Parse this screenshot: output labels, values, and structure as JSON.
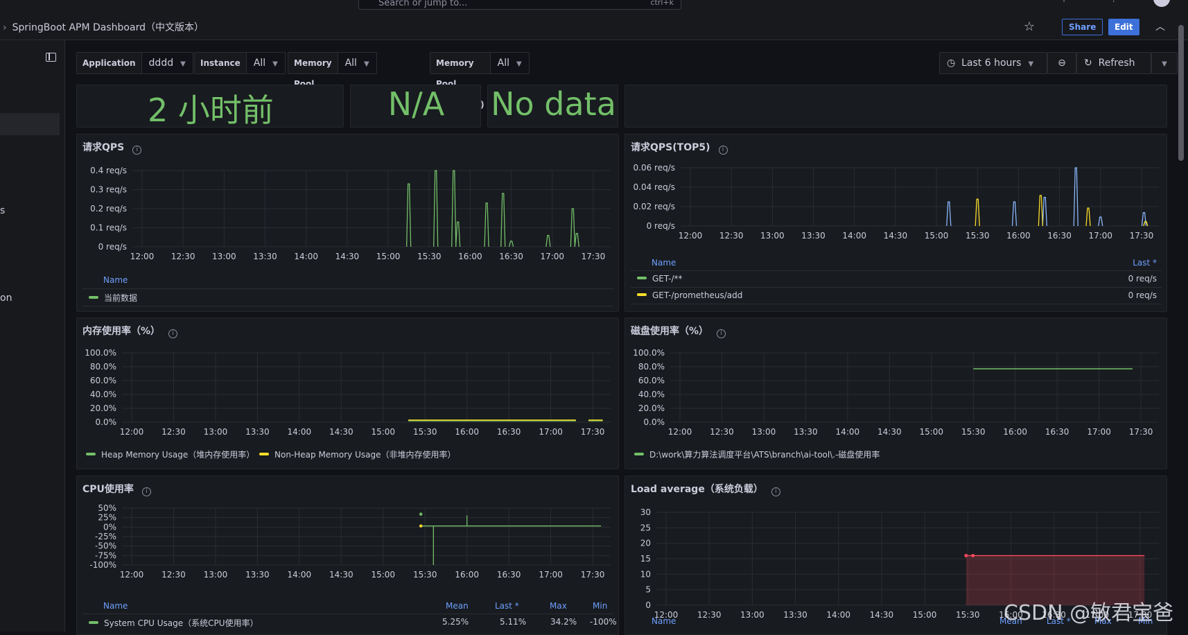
{
  "topbar": {
    "search_placeholder": "Search or jump to...",
    "search_shortcut": "ctrl+k",
    "breadcrumb": "SpringBoot APM Dashboard（中文版本）",
    "share_label": "Share",
    "edit_label": "Edit"
  },
  "sidebar": {
    "fragments": [
      "s",
      "on"
    ]
  },
  "variables": [
    {
      "label": "Application",
      "value": "dddd"
    },
    {
      "label": "Instance",
      "value": "All"
    },
    {
      "label": "Memory Pool (heap)",
      "value": "All"
    },
    {
      "label": "Memory Pool (nonheap)",
      "value": "All"
    }
  ],
  "time": {
    "range_label": "Last 6 hours",
    "refresh_label": "Refresh"
  },
  "stats": {
    "uptime": "2 小时前",
    "stat2": "N/A",
    "stat3": "No data"
  },
  "colors": {
    "green": "#73bf69",
    "yellow": "#fade2a",
    "blue": "#8ab8ff",
    "red": "#f2495c",
    "accent": "#3d71d9"
  },
  "panels": {
    "qps": {
      "title": "请求QPS",
      "legend_header": "Name",
      "legend": [
        {
          "name": "当前数据",
          "color": "#73bf69"
        }
      ]
    },
    "qps_top5": {
      "title": "请求QPS(TOP5)",
      "legend_header": "Name",
      "legend_col": "Last *",
      "legend": [
        {
          "name": "GET-/**",
          "color": "#73bf69",
          "last": "0 req/s"
        },
        {
          "name": "GET-/prometheus/add",
          "color": "#fade2a",
          "last": "0 req/s"
        }
      ]
    },
    "memory": {
      "title": "内存使用率（%）",
      "legend": [
        {
          "name": "Heap Memory Usage（堆内存使用率）",
          "color": "#73bf69"
        },
        {
          "name": "Non-Heap Memory Usage（非堆内存使用率）",
          "color": "#fade2a"
        }
      ]
    },
    "disk": {
      "title": "磁盘使用率（%）",
      "legend": [
        {
          "name": "D:\\work\\算力算法调度平台\\ATS\\branch\\ai-tool\\.-磁盘使用率",
          "color": "#73bf69"
        }
      ]
    },
    "cpu": {
      "title": "CPU使用率",
      "legend_header": "Name",
      "legend_cols": [
        "Mean",
        "Last *",
        "Max",
        "Min"
      ],
      "legend": [
        {
          "name": "System CPU Usage（系统CPU使用率）",
          "color": "#73bf69",
          "mean": "5.25%",
          "last": "5.11%",
          "max": "34.2%",
          "min": "-100%"
        }
      ]
    },
    "load": {
      "title": "Load average（系统负载）",
      "legend_header": "Name",
      "legend_cols": [
        "Mean",
        "Last *",
        "Max",
        "Min"
      ]
    }
  },
  "chart_data": [
    {
      "type": "line",
      "panel": "请求QPS",
      "x": [
        "12:00",
        "12:30",
        "13:00",
        "13:30",
        "14:00",
        "14:30",
        "15:00",
        "15:30",
        "16:00",
        "16:30",
        "17:00",
        "17:30"
      ],
      "y_ticks": [
        "0 req/s",
        "0.1 req/s",
        "0.2 req/s",
        "0.3 req/s",
        "0.4 req/s"
      ],
      "ylim": [
        0,
        0.4
      ],
      "series": [
        {
          "name": "当前数据",
          "color": "#73bf69",
          "points": [
            [
              15.25,
              0.33
            ],
            [
              15.58,
              0.4
            ],
            [
              15.8,
              0.4
            ],
            [
              15.85,
              0.13
            ],
            [
              16.2,
              0.23
            ],
            [
              16.4,
              0.28
            ],
            [
              16.5,
              0.03
            ],
            [
              16.95,
              0.06
            ],
            [
              17.25,
              0.2
            ],
            [
              17.3,
              0.07
            ]
          ]
        }
      ]
    },
    {
      "type": "line",
      "panel": "请求QPS(TOP5)",
      "x": [
        "12:00",
        "12:30",
        "13:00",
        "13:30",
        "14:00",
        "14:30",
        "15:00",
        "15:30",
        "16:00",
        "16:30",
        "17:00",
        "17:30"
      ],
      "y_ticks": [
        "0 req/s",
        "0.02 req/s",
        "0.04 req/s",
        "0.06 req/s"
      ],
      "ylim": [
        0,
        0.065
      ],
      "series": [
        {
          "name": "GET-/**",
          "color": "#8ab8ff",
          "points": [
            [
              15.15,
              0.027
            ],
            [
              15.95,
              0.027
            ],
            [
              16.32,
              0.032
            ],
            [
              16.7,
              0.065
            ],
            [
              17.0,
              0.01
            ],
            [
              17.53,
              0.015
            ]
          ]
        },
        {
          "name": "GET-/prometheus/add",
          "color": "#fade2a",
          "points": [
            [
              15.5,
              0.03
            ],
            [
              16.27,
              0.034
            ],
            [
              16.85,
              0.02
            ],
            [
              17.55,
              0.005
            ]
          ]
        }
      ]
    },
    {
      "type": "line",
      "panel": "内存使用率（%）",
      "x": [
        "12:00",
        "12:30",
        "13:00",
        "13:30",
        "14:00",
        "14:30",
        "15:00",
        "15:30",
        "16:00",
        "16:30",
        "17:00",
        "17:30"
      ],
      "y_ticks": [
        "0.0%",
        "20.0%",
        "40.0%",
        "60.0%",
        "80.0%",
        "100.0%"
      ],
      "ylim": [
        0,
        100
      ],
      "series": [
        {
          "name": "Heap Memory Usage（堆内存使用率）",
          "color": "#73bf69",
          "segments": [
            [
              15.3,
              17.3,
              2
            ],
            [
              17.45,
              17.62,
              2
            ]
          ]
        },
        {
          "name": "Non-Heap Memory Usage（非堆内存使用率）",
          "color": "#fade2a",
          "segments": [
            [
              15.3,
              17.3,
              3
            ],
            [
              17.45,
              17.62,
              3
            ]
          ]
        }
      ]
    },
    {
      "type": "line",
      "panel": "磁盘使用率（%）",
      "x": [
        "12:00",
        "12:30",
        "13:00",
        "13:30",
        "14:00",
        "14:30",
        "15:00",
        "15:30",
        "16:00",
        "16:30",
        "17:00",
        "17:30"
      ],
      "y_ticks": [
        "0.0%",
        "20.0%",
        "40.0%",
        "60.0%",
        "80.0%",
        "100.0%"
      ],
      "ylim": [
        0,
        100
      ],
      "series": [
        {
          "name": "D:\\work\\算力算法调度平台\\ATS\\branch\\ai-tool\\.-磁盘使用率",
          "color": "#73bf69",
          "segments": [
            [
              15.5,
              17.4,
              77
            ]
          ]
        }
      ]
    },
    {
      "type": "line",
      "panel": "CPU使用率",
      "x": [
        "12:00",
        "12:30",
        "13:00",
        "13:30",
        "14:00",
        "14:30",
        "15:00",
        "15:30",
        "16:00",
        "16:30",
        "17:00",
        "17:30"
      ],
      "y_ticks": [
        "-100%",
        "-75%",
        "-50%",
        "-25%",
        "0%",
        "25%",
        "50%"
      ],
      "ylim": [
        -100,
        50
      ],
      "series": [
        {
          "name": "System CPU Usage（系统CPU使用率）",
          "color": "#73bf69",
          "mean": 5.25,
          "last": 5.11,
          "max": 34.2,
          "min": -100
        }
      ]
    },
    {
      "type": "area",
      "panel": "Load average（系统负载）",
      "x": [
        "12:00",
        "12:30",
        "13:00",
        "13:30",
        "14:00",
        "14:30",
        "15:00",
        "15:30",
        "16:00",
        "16:30",
        "17:00",
        "17:30"
      ],
      "y_ticks": [
        "0",
        "5",
        "10",
        "15",
        "20",
        "25",
        "30"
      ],
      "ylim": [
        0,
        30
      ],
      "series": [
        {
          "name": "",
          "color": "#f2495c",
          "segments": [
            [
              15.48,
              17.55,
              16
            ]
          ]
        }
      ]
    }
  ],
  "watermark": "CSDN @敏君宝爸"
}
